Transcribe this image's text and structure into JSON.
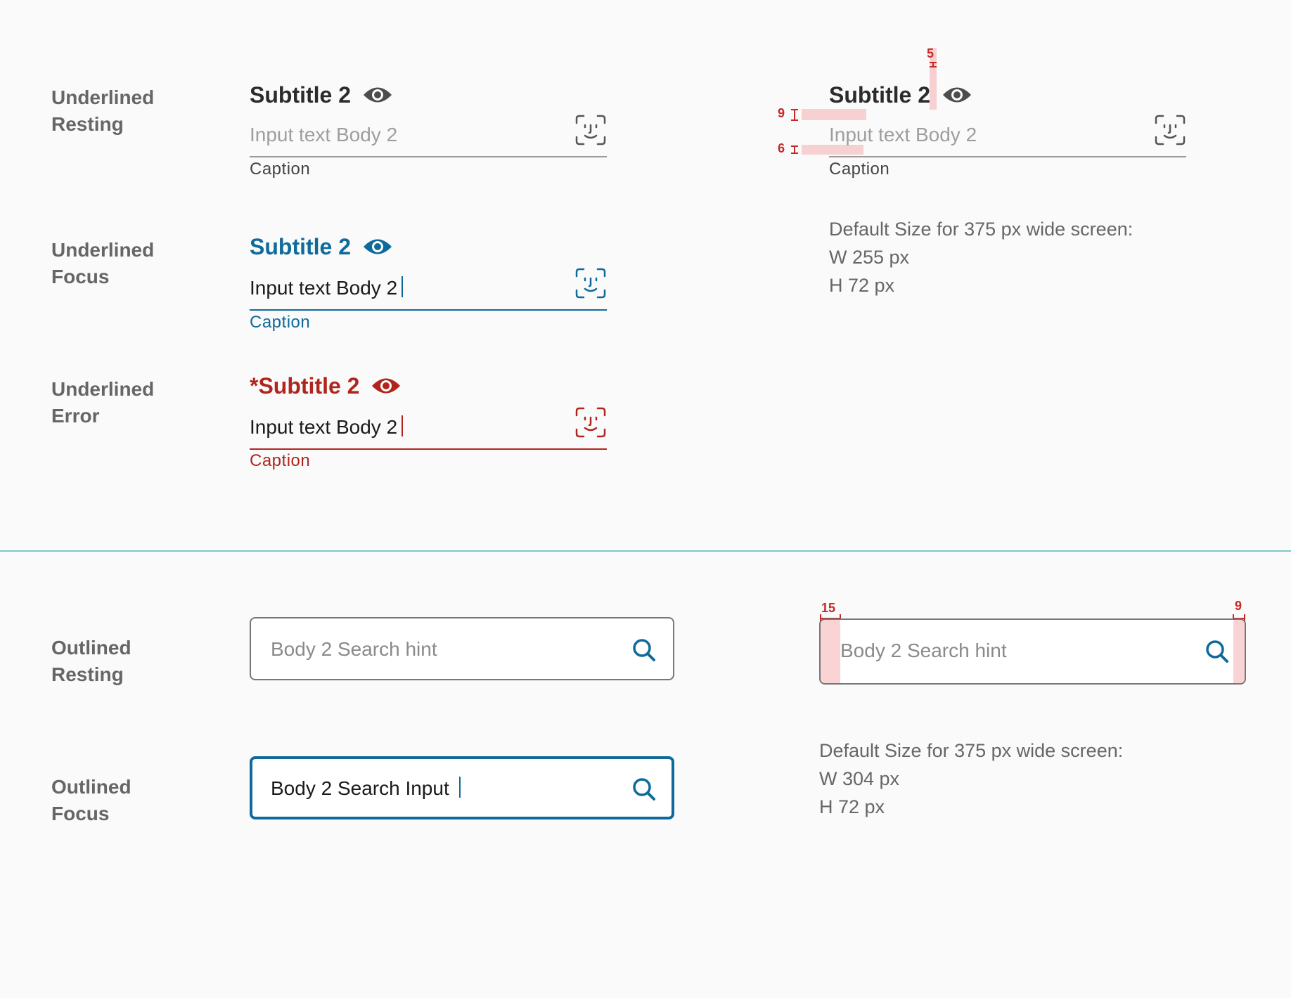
{
  "colors": {
    "background": "#fafafa",
    "text_dark": "#2b2b2b",
    "text_gray": "#666666",
    "hint_gray": "#9e9e9e",
    "focus_blue": "#0e6a9b",
    "error_red": "#b0261e",
    "divider_teal": "#7ec6cf",
    "redline": "#c62828"
  },
  "rows": [
    {
      "label_line1": "Underlined",
      "label_line2": "Resting"
    },
    {
      "label_line1": "Underlined",
      "label_line2": "Focus"
    },
    {
      "label_line1": "Underlined",
      "label_line2": "Error"
    },
    {
      "label_line1": "Outlined",
      "label_line2": "Resting"
    },
    {
      "label_line1": "Outlined",
      "label_line2": "Focus"
    }
  ],
  "underlined": {
    "resting": {
      "subtitle": "Subtitle 2",
      "placeholder": "Input text Body 2",
      "caption": "Caption",
      "eye_icon": "eye-icon",
      "face_icon": "face-id-icon"
    },
    "focus": {
      "subtitle": "Subtitle 2",
      "value": "Input text Body 2",
      "caption": "Caption"
    },
    "error": {
      "subtitle": "*Subtitle 2",
      "value": "Input text Body 2",
      "caption": "Caption"
    }
  },
  "spec_underlined": {
    "subtitle": "Subtitle 2",
    "placeholder": "Input text Body 2",
    "caption": "Caption",
    "measure_top": "5",
    "measure_mid": "9",
    "measure_bottom": "6",
    "note_line1": "Default Size for 375 px wide screen:",
    "note_line2": "W 255 px",
    "note_line3": "H 72 px"
  },
  "outlined": {
    "resting": {
      "placeholder": "Body 2 Search hint",
      "search_icon": "search-icon"
    },
    "focus": {
      "value": "Body 2 Search Input"
    }
  },
  "spec_outlined": {
    "placeholder": "Body 2 Search hint",
    "measure_left": "15",
    "measure_right": "9",
    "note_line1": "Default Size for 375 px wide screen:",
    "note_line2": "W 304 px",
    "note_line3": "H 72 px"
  }
}
